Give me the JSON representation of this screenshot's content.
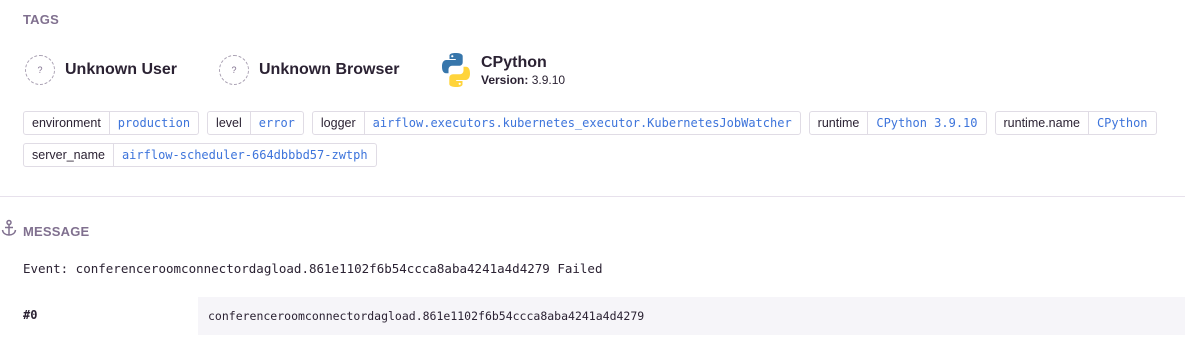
{
  "tags_section": {
    "title": "TAGS",
    "contexts": [
      {
        "name": "Unknown User",
        "icon": "unknown-icon"
      },
      {
        "name": "Unknown Browser",
        "icon": "unknown-icon"
      },
      {
        "name": "CPython",
        "version_label": "Version:",
        "version": "3.9.10",
        "icon": "python-logo-icon"
      }
    ],
    "unknown_glyph": "?",
    "items": [
      {
        "key": "environment",
        "value": "production"
      },
      {
        "key": "level",
        "value": "error"
      },
      {
        "key": "logger",
        "value": "airflow.executors.kubernetes_executor.KubernetesJobWatcher"
      },
      {
        "key": "runtime",
        "value": "CPython 3.9.10"
      },
      {
        "key": "runtime.name",
        "value": "CPython"
      },
      {
        "key": "server_name",
        "value": "airflow-scheduler-664dbbbd57-zwtph"
      }
    ]
  },
  "message_section": {
    "title": "MESSAGE",
    "text": "Event: conferenceroomconnectordagload.861e1102f6b54ccca8aba4241a4d4279 Failed",
    "params": [
      {
        "key": "#0",
        "value": "conferenceroomconnectordagload.861e1102f6b54ccca8aba4241a4d4279"
      }
    ]
  },
  "colors": {
    "tag_value": "#3d74db",
    "section_title": "#80708f",
    "border": "#e0dce5",
    "python_blue": "#3776ab",
    "python_yellow": "#ffd43b"
  }
}
